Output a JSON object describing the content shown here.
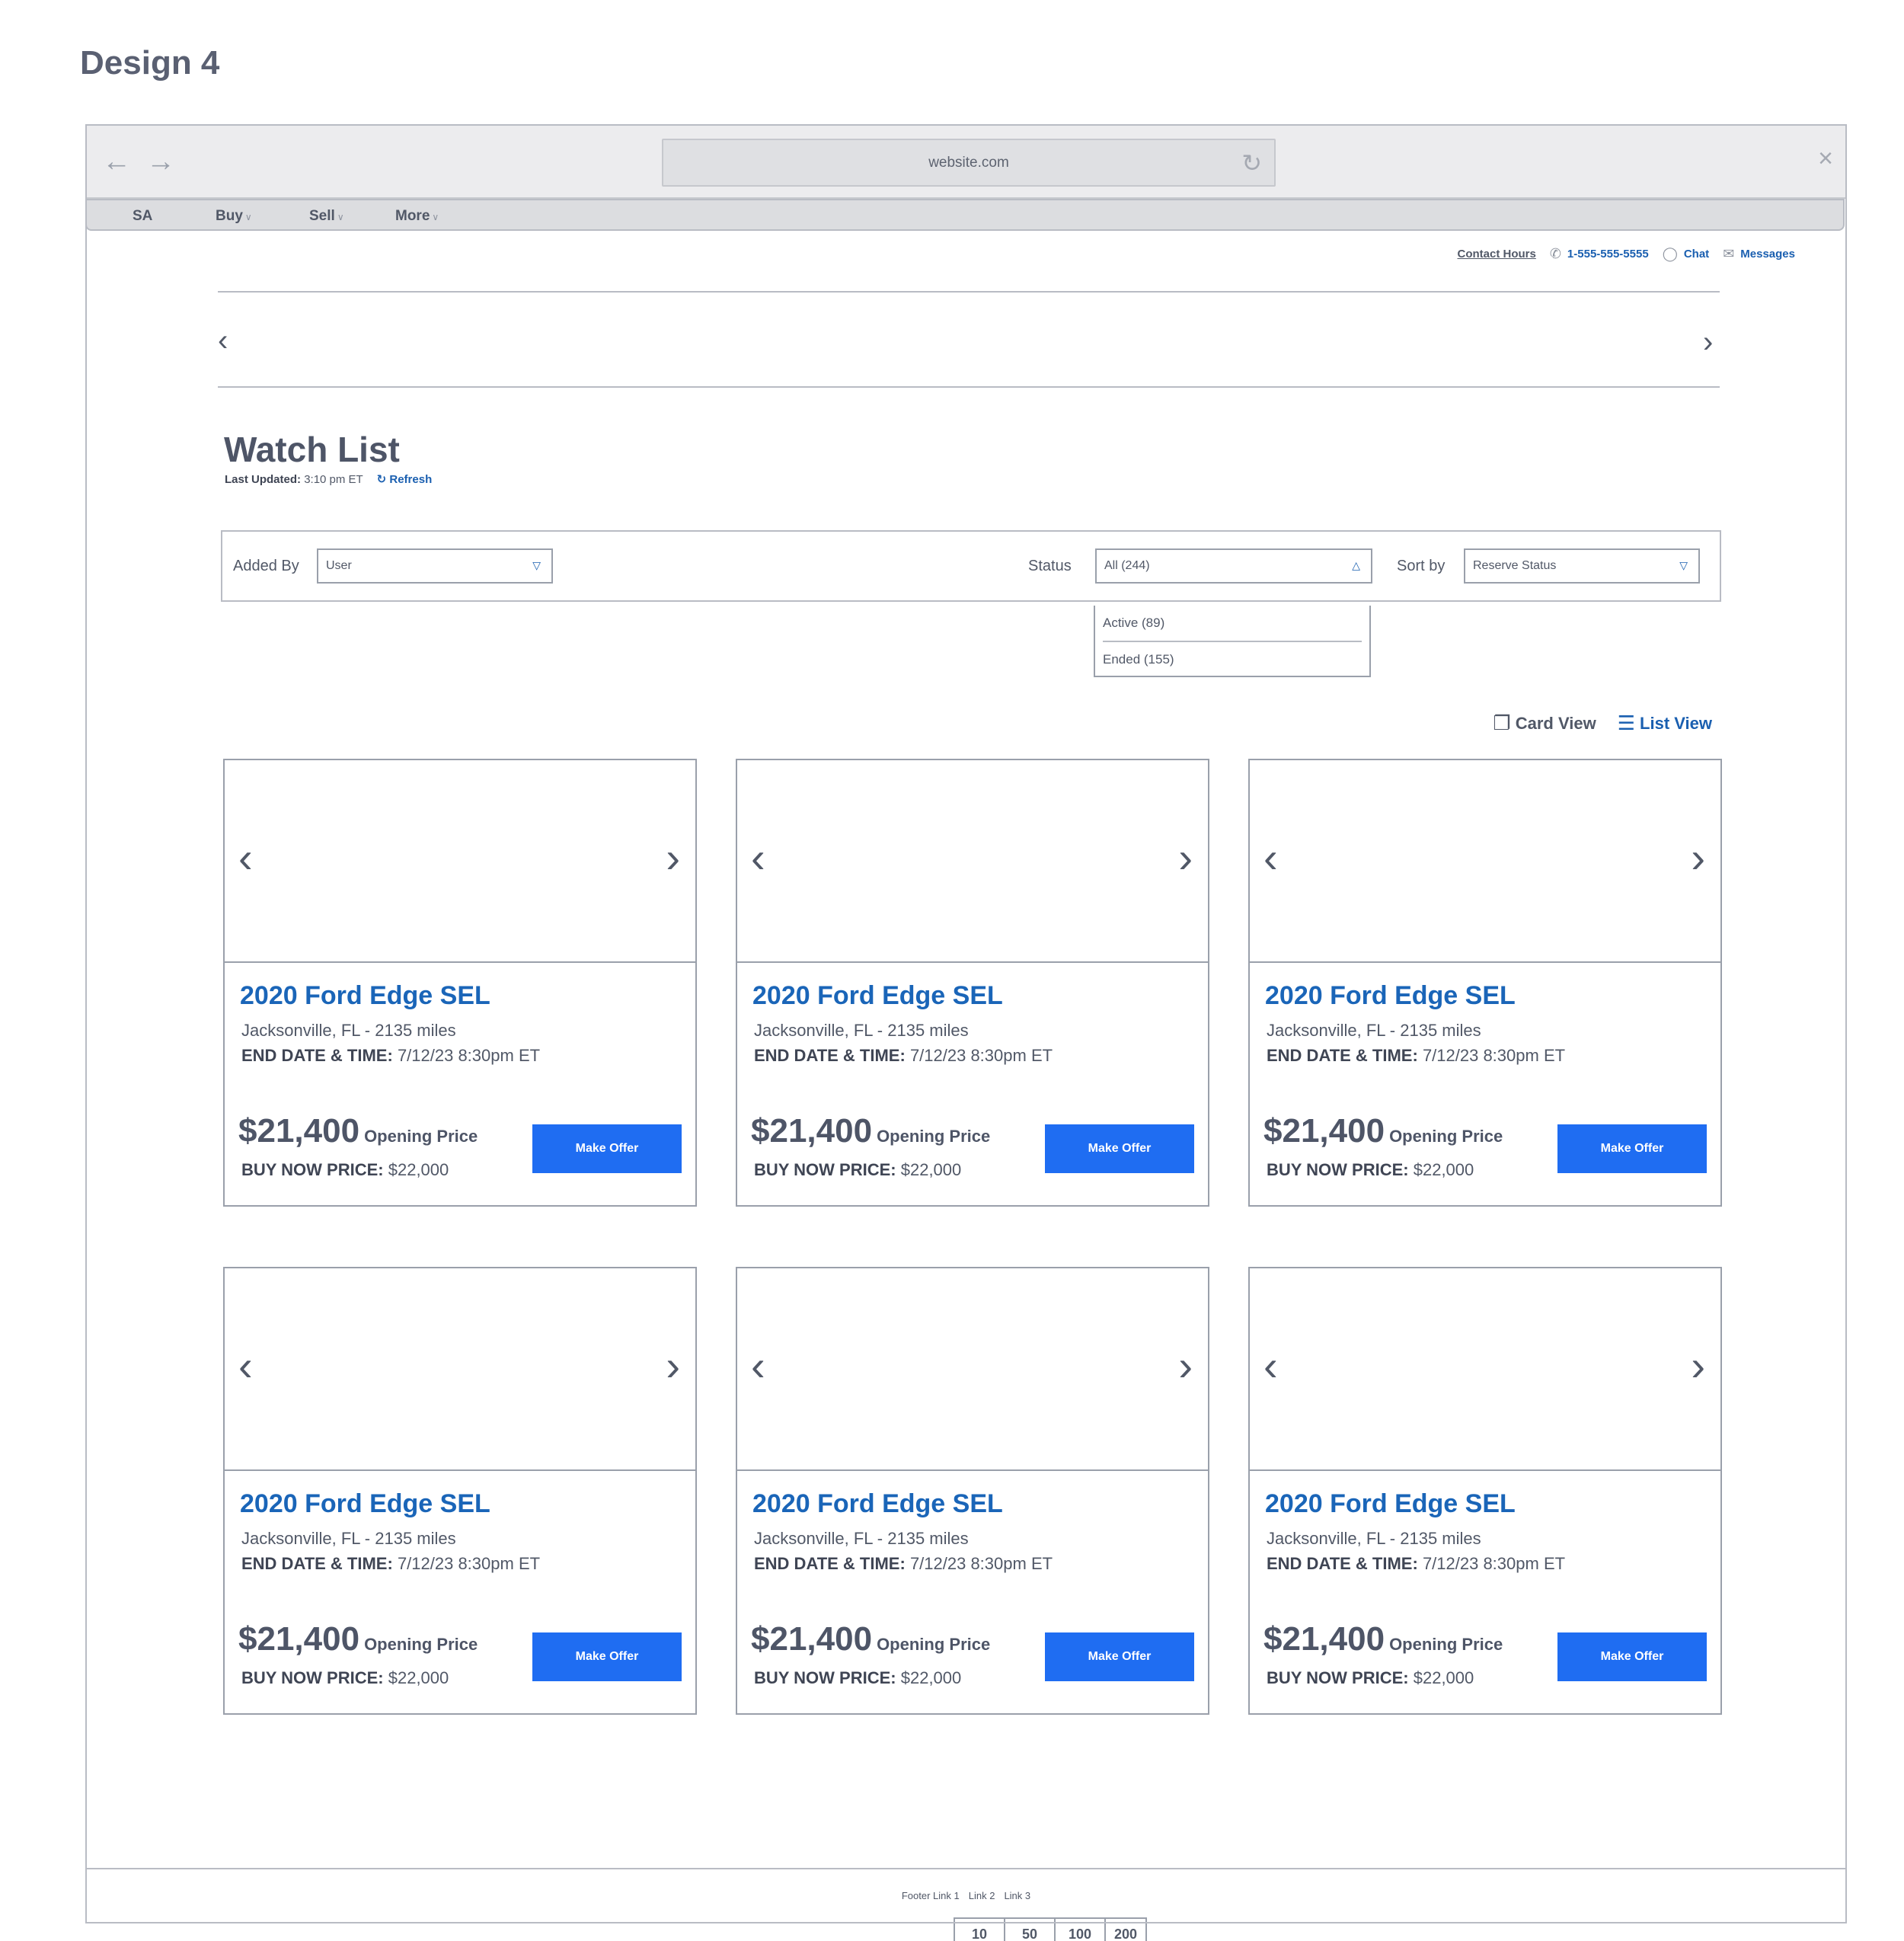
{
  "design_label": "Design 4",
  "browser": {
    "url": "website.com",
    "icons": {
      "back": "arrow-left-icon",
      "forward": "arrow-right-icon",
      "reload": "reload-icon",
      "close": "close-icon"
    }
  },
  "menu": {
    "items": [
      {
        "label": "SA",
        "has_chevron": false
      },
      {
        "label": "Buy",
        "has_chevron": true
      },
      {
        "label": "Sell",
        "has_chevron": true
      },
      {
        "label": "More",
        "has_chevron": true
      }
    ]
  },
  "utility": {
    "contact_hours": "Contact Hours",
    "phone": "1-555-555-5555",
    "chat": "Chat",
    "messages": "Messages"
  },
  "page": {
    "title": "Watch List",
    "last_updated_label": "Last Updated:",
    "last_updated_value": "3:10 pm ET",
    "refresh_label": "Refresh"
  },
  "filters": {
    "added_by_label": "Added By",
    "added_by_value": "User",
    "status_label": "Status",
    "status_value": "All (244)",
    "status_options": [
      "Active (89)",
      "Ended (155)"
    ],
    "sort_label": "Sort by",
    "sort_value": "Reserve Status"
  },
  "view_toggle": {
    "card_view": "Card View",
    "list_view": "List View"
  },
  "listings": [
    {
      "title": "2020 Ford Edge SEL",
      "location": "Jacksonville, FL - 2135 miles",
      "end_label": "END DATE & TIME:",
      "end_value": "7/12/23 8:30pm ET",
      "price": "$21,400",
      "price_label": "Opening Price",
      "buy_now_label": "BUY NOW PRICE:",
      "buy_now_value": "$22,000",
      "cta": "Make Offer"
    },
    {
      "title": "2020 Ford Edge SEL",
      "location": "Jacksonville, FL - 2135 miles",
      "end_label": "END DATE & TIME:",
      "end_value": "7/12/23 8:30pm ET",
      "price": "$21,400",
      "price_label": "Opening Price",
      "buy_now_label": "BUY NOW PRICE:",
      "buy_now_value": "$22,000",
      "cta": "Make Offer"
    },
    {
      "title": "2020 Ford Edge SEL",
      "location": "Jacksonville, FL - 2135 miles",
      "end_label": "END DATE & TIME:",
      "end_value": "7/12/23 8:30pm ET",
      "price": "$21,400",
      "price_label": "Opening Price",
      "buy_now_label": "BUY NOW PRICE:",
      "buy_now_value": "$22,000",
      "cta": "Make Offer"
    },
    {
      "title": "2020 Ford Edge SEL",
      "location": "Jacksonville, FL - 2135 miles",
      "end_label": "END DATE & TIME:",
      "end_value": "7/12/23 8:30pm ET",
      "price": "$21,400",
      "price_label": "Opening Price",
      "buy_now_label": "BUY NOW PRICE:",
      "buy_now_value": "$22,000",
      "cta": "Make Offer"
    },
    {
      "title": "2020 Ford Edge SEL",
      "location": "Jacksonville, FL - 2135 miles",
      "end_label": "END DATE & TIME:",
      "end_value": "7/12/23 8:30pm ET",
      "price": "$21,400",
      "price_label": "Opening Price",
      "buy_now_label": "BUY NOW PRICE:",
      "buy_now_value": "$22,000",
      "cta": "Make Offer"
    },
    {
      "title": "2020 Ford Edge SEL",
      "location": "Jacksonville, FL - 2135 miles",
      "end_label": "END DATE & TIME:",
      "end_value": "7/12/23 8:30pm ET",
      "price": "$21,400",
      "price_label": "Opening Price",
      "buy_now_label": "BUY NOW PRICE:",
      "buy_now_value": "$22,000",
      "cta": "Make Offer"
    }
  ],
  "pagination": [
    "10",
    "50",
    "100",
    "200"
  ],
  "footer": [
    "Footer Link 1",
    "Link 2",
    "Link 3"
  ],
  "colors": {
    "accent": "#1f6df2",
    "link": "#1a65b8",
    "text": "#515867",
    "border": "#9aa0ab"
  }
}
